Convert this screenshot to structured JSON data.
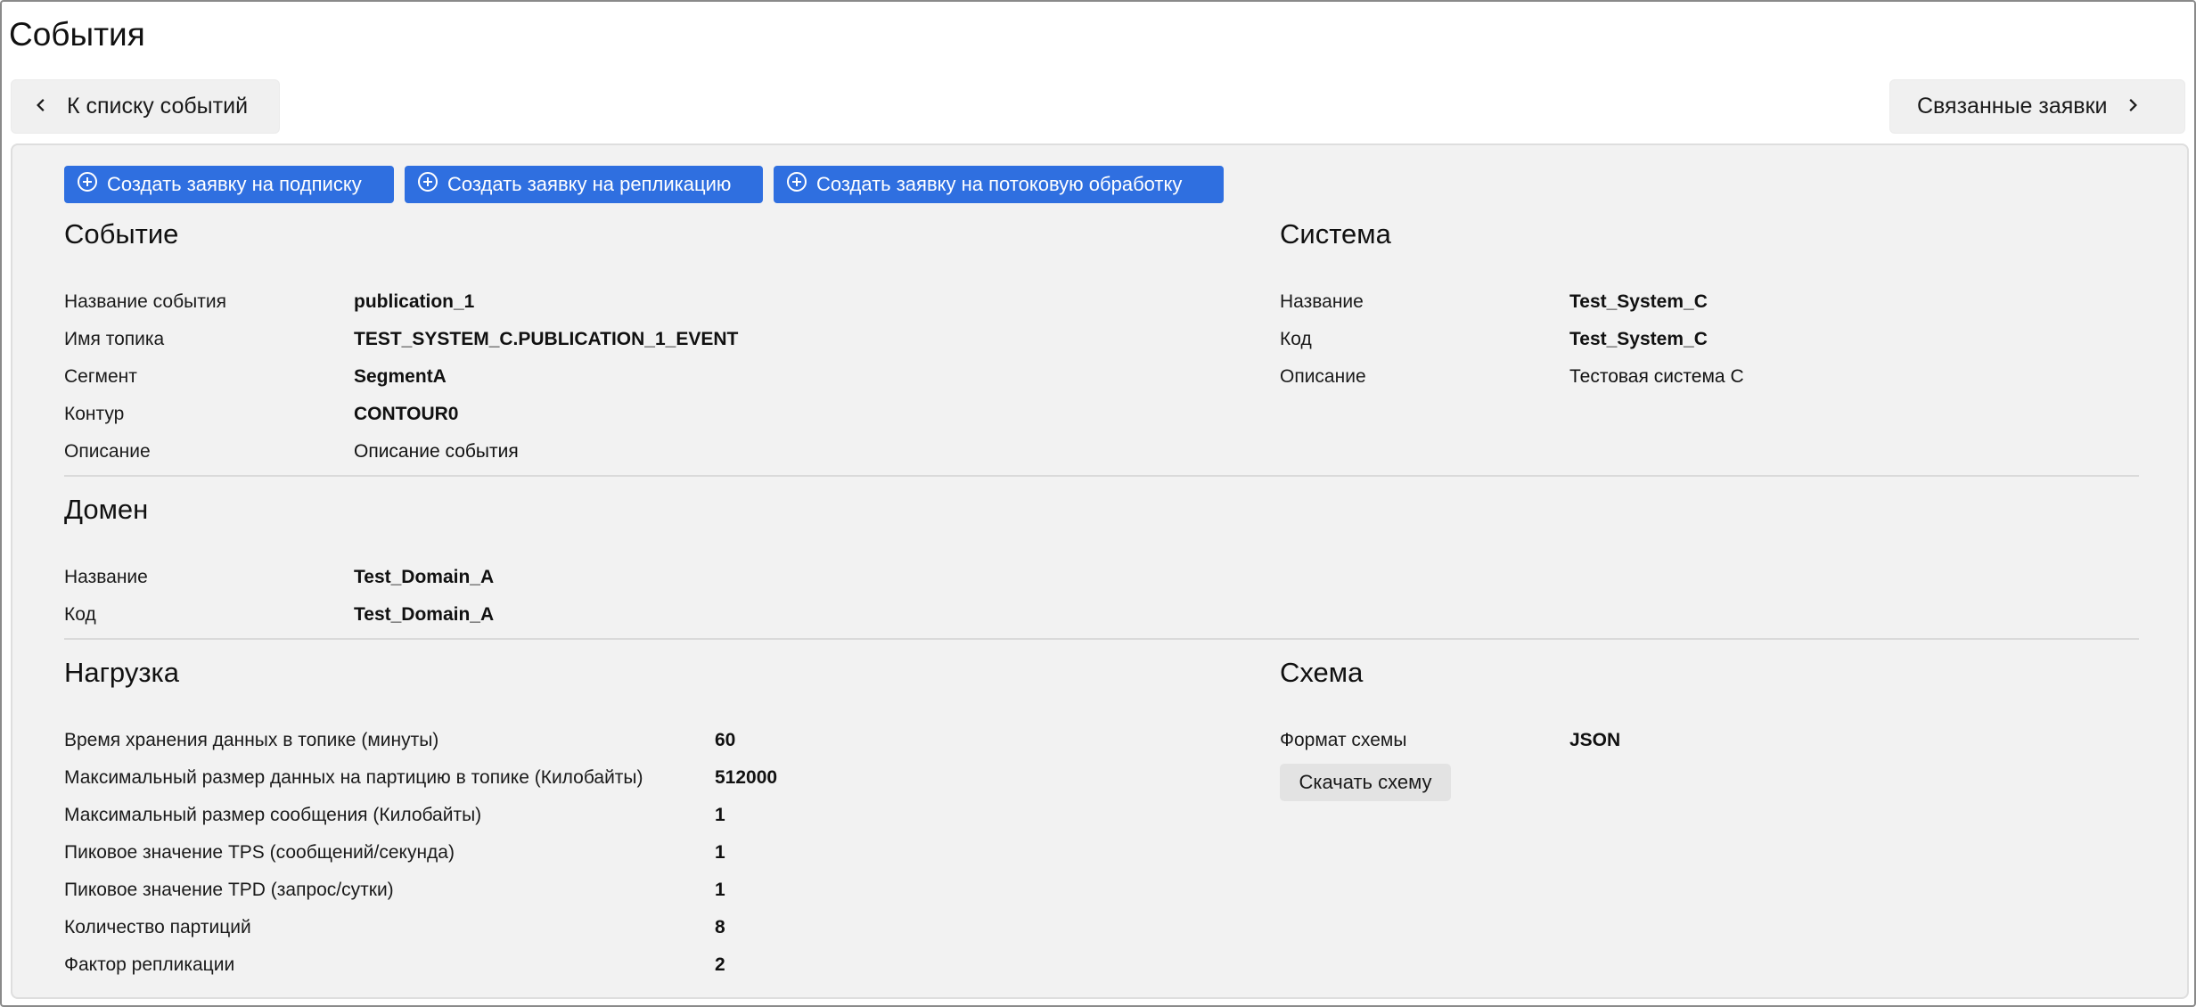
{
  "page": {
    "title": "События"
  },
  "nav": {
    "back_label": "К списку событий",
    "related_label": "Связанные заявки"
  },
  "actions": {
    "subscription": "Создать заявку на подписку",
    "replication": "Создать заявку на репликацию",
    "stream": "Создать заявку на потоковую обработку"
  },
  "event": {
    "title": "Событие",
    "fields": [
      {
        "label": "Название события",
        "value": "publication_1"
      },
      {
        "label": "Имя топика",
        "value": "TEST_SYSTEM_C.PUBLICATION_1_EVENT"
      },
      {
        "label": "Сегмент",
        "value": "SegmentA"
      },
      {
        "label": "Контур",
        "value": "CONTOUR0"
      },
      {
        "label": "Описание",
        "value": "Описание события"
      }
    ]
  },
  "system": {
    "title": "Система",
    "fields": [
      {
        "label": "Название",
        "value": "Test_System_C"
      },
      {
        "label": "Код",
        "value": "Test_System_C"
      },
      {
        "label": "Описание",
        "value": "Тестовая система С"
      }
    ]
  },
  "domain": {
    "title": "Домен",
    "fields": [
      {
        "label": "Название",
        "value": "Test_Domain_A"
      },
      {
        "label": "Код",
        "value": "Test_Domain_A"
      }
    ]
  },
  "load": {
    "title": "Нагрузка",
    "fields": [
      {
        "label": "Время хранения данных в топике (минуты)",
        "value": "60"
      },
      {
        "label": "Максимальный размер данных на партицию в топике (Килобайты)",
        "value": "512000"
      },
      {
        "label": "Максимальный размер сообщения (Килобайты)",
        "value": "1"
      },
      {
        "label": "Пиковое значение TPS (сообщений/секунда)",
        "value": "1"
      },
      {
        "label": "Пиковое значение TPD (запрос/сутки)",
        "value": "1"
      },
      {
        "label": "Количество партиций",
        "value": "8"
      },
      {
        "label": "Фактор репликации",
        "value": "2"
      }
    ]
  },
  "schema": {
    "title": "Схема",
    "fields": [
      {
        "label": "Формат схемы",
        "value": "JSON"
      }
    ],
    "download_label": "Скачать схему"
  },
  "colors": {
    "primary": "#2f6fe0",
    "card_bg": "#f2f2f2"
  },
  "icons": {
    "back": "chevron-left-icon",
    "forward": "chevron-right-icon",
    "add": "plus-circle-icon"
  }
}
